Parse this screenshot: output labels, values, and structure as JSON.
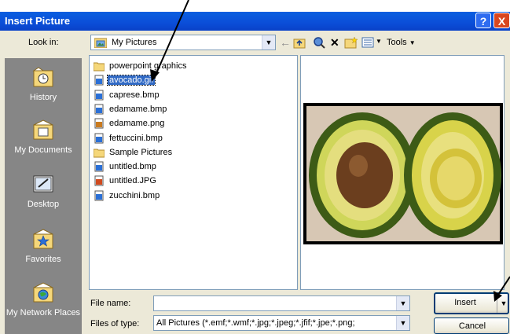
{
  "window": {
    "title": "Insert Picture",
    "help_glyph": "?",
    "close_glyph": "X"
  },
  "lookin": {
    "label": "Look in:",
    "value": "My Pictures"
  },
  "toolbar": {
    "tools_label": "Tools"
  },
  "places": [
    {
      "label": "History",
      "icon": "history-icon"
    },
    {
      "label": "My Documents",
      "icon": "my-documents-icon"
    },
    {
      "label": "Desktop",
      "icon": "desktop-icon"
    },
    {
      "label": "Favorites",
      "icon": "favorites-icon"
    },
    {
      "label": "My Network Places",
      "icon": "network-places-icon"
    }
  ],
  "files": [
    {
      "name": "powerpoint graphics",
      "type": "folder"
    },
    {
      "name": "avocado.gif",
      "type": "gif",
      "selected": true
    },
    {
      "name": "caprese.bmp",
      "type": "bmp"
    },
    {
      "name": "edamame.bmp",
      "type": "bmp"
    },
    {
      "name": "edamame.png",
      "type": "png"
    },
    {
      "name": "fettuccini.bmp",
      "type": "bmp"
    },
    {
      "name": "Sample Pictures",
      "type": "folder"
    },
    {
      "name": "untitled.bmp",
      "type": "bmp"
    },
    {
      "name": "untitled.JPG",
      "type": "jpg"
    },
    {
      "name": "zucchini.bmp",
      "type": "bmp"
    }
  ],
  "filename": {
    "label": "File name:",
    "value": ""
  },
  "filetype": {
    "label": "Files of type:",
    "value": "All Pictures (*.emf;*.wmf;*.jpg;*.jpeg;*.jfif;*.jpe;*.png;"
  },
  "buttons": {
    "insert": "Insert",
    "cancel": "Cancel"
  }
}
